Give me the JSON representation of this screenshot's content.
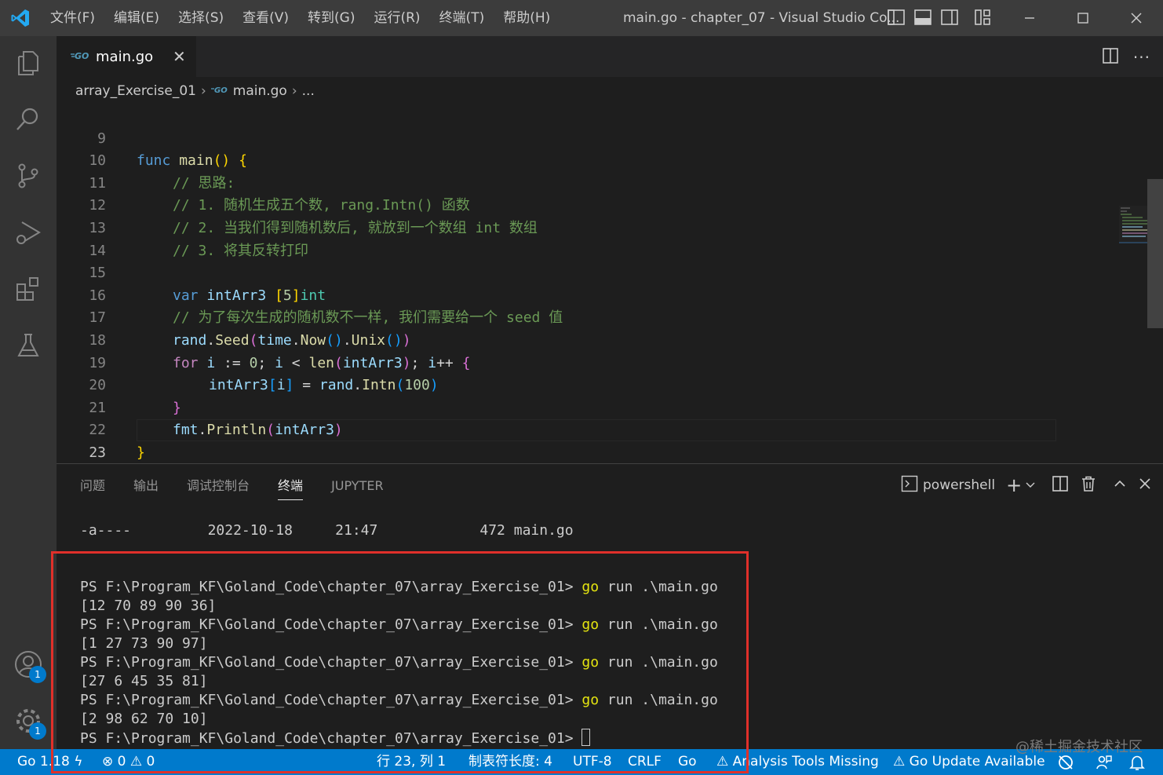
{
  "titlebar": {
    "menu": [
      "文件(F)",
      "编辑(E)",
      "选择(S)",
      "查看(V)",
      "转到(G)",
      "运行(R)",
      "终端(T)",
      "帮助(H)"
    ],
    "window_title": "main.go - chapter_07 - Visual Studio Co..."
  },
  "activity": {
    "accounts_badge": "1",
    "settings_badge": "1"
  },
  "editor": {
    "tab_label": "main.go",
    "breadcrumb": {
      "folder": "array_Exercise_01",
      "file": "main.go",
      "more": "..."
    },
    "line_numbers": [
      "9",
      "10",
      "11",
      "12",
      "13",
      "14",
      "15",
      "16",
      "17",
      "18",
      "19",
      "20",
      "21",
      "22",
      "23"
    ],
    "code": {
      "l9": {
        "kw": "func",
        "fn": "main",
        "paren": "()",
        "brace": "{"
      },
      "l10": "// 思路:",
      "l11": "// 1. 随机生成五个数, rang.Intn() 函数",
      "l12": "// 2. 当我们得到随机数后, 就放到一个数组 int 数组",
      "l13": "// 3. 将其反转打印",
      "l15": {
        "kw": "var",
        "name": "intArr3",
        "size": "5",
        "type": "int"
      },
      "l16": "// 为了每次生成的随机数不一样, 我们需要给一个 seed 值",
      "l17": {
        "pkg": "rand",
        "fn": "Seed",
        "pkg2": "time",
        "fn2": "Now",
        "fn3": "Unix"
      },
      "l18": {
        "kw": "for",
        "var": "i",
        "zero": "0",
        "len": "len",
        "arr": "intArr3"
      },
      "l19": {
        "arr": "intArr3",
        "idx": "i",
        "pkg": "rand",
        "fn": "Intn",
        "num": "100"
      },
      "l21": {
        "pkg": "fmt",
        "fn": "Println",
        "arr": "intArr3"
      }
    }
  },
  "panel": {
    "tabs": [
      "问题",
      "输出",
      "调试控制台",
      "终端",
      "JUPYTER"
    ],
    "active_tab": "终端",
    "shell": "powershell",
    "listing": {
      "mode": "-a----",
      "date": "2022-10-18",
      "time": "21:47",
      "size": "472",
      "name": "main.go"
    },
    "prompt": "PS F:\\Program_KF\\Goland_Code\\chapter_07\\array_Exercise_01>",
    "command_go": "go",
    "command_rest": "run .\\main.go",
    "outputs": [
      "[12 70 89 90 36]",
      "[1 27 73 90 97]",
      "[27 6 45 35 81]",
      "[2 98 62 70 10]"
    ]
  },
  "statusbar": {
    "go_version": "Go 1.18",
    "errors": "0",
    "warnings": "0",
    "position": "行 23, 列 1",
    "tab_size": "制表符长度: 4",
    "encoding": "UTF-8",
    "eol": "CRLF",
    "language": "Go",
    "analysis": "Analysis Tools Missing",
    "update": "Go Update Available"
  },
  "watermark": "@稀土掘金技术社区",
  "colors": {
    "statusbar": "#007acc",
    "highlight_box": "#e0302a",
    "keyword": "#569cd6",
    "comment": "#6a9955"
  }
}
